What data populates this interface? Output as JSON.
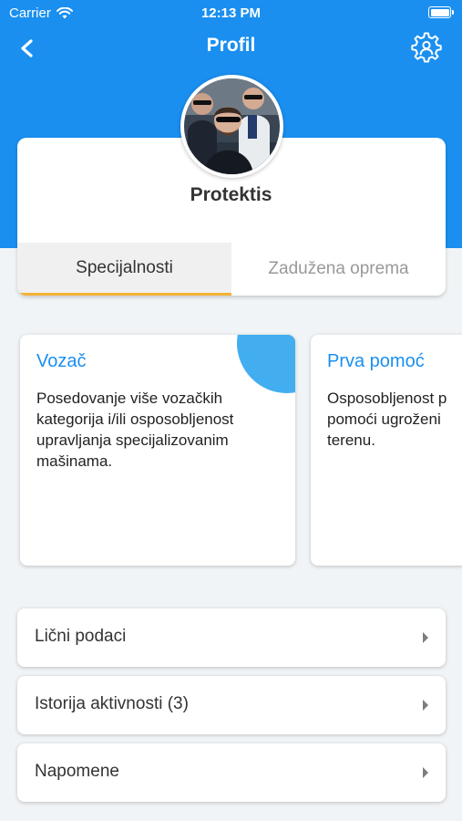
{
  "status_bar": {
    "carrier": "Carrier",
    "time": "12:13 PM"
  },
  "header": {
    "title": "Profil",
    "back_icon": "chevron-left-icon",
    "settings_icon": "user-gear-icon"
  },
  "profile": {
    "name": "Protektis"
  },
  "tabs": [
    {
      "label": "Specijalnosti",
      "active": true
    },
    {
      "label": "Zadužena oprema",
      "active": false
    }
  ],
  "specialties": [
    {
      "title": "Vozač",
      "description": "Posedovanje više vozačkih\nkategorija i/ili osposobljenost\nupravljanja specijalizovanim\nmašinama.",
      "icon": "driver-icon"
    },
    {
      "title": "Prva pomoć",
      "description": "Osposobljenost p\npomoći ugroženi\nterenu."
    }
  ],
  "menu": [
    {
      "label": "Lični podaci"
    },
    {
      "label": "Istorija aktivnosti (3)"
    },
    {
      "label": "Napomene"
    }
  ],
  "colors": {
    "primary": "#1a8ff0",
    "tab_indicator": "#f2b233",
    "badge": "#42aef0"
  }
}
